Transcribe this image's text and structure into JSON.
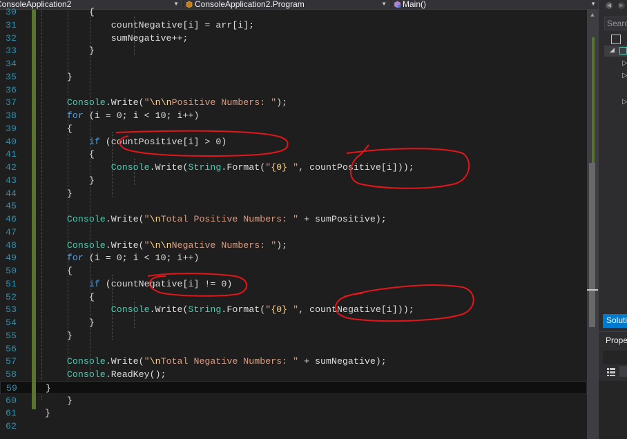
{
  "navbar": {
    "project": "ConsoleApplication2",
    "class": "ConsoleApplication2.Program",
    "member": "Main()"
  },
  "code": {
    "lines": [
      {
        "num": "30",
        "text": "                {"
      },
      {
        "num": "31",
        "text": "                    countNegative[i] = arr[i];"
      },
      {
        "num": "32",
        "text": "                    sumNegative++;"
      },
      {
        "num": "33",
        "text": "                }"
      },
      {
        "num": "34",
        "text": ""
      },
      {
        "num": "35",
        "text": "            }"
      },
      {
        "num": "36",
        "text": ""
      },
      {
        "num": "37",
        "text": "            Console.Write(\"\\n\\nPositive Numbers: \");"
      },
      {
        "num": "38",
        "text": "            for (i = 0; i < 10; i++)"
      },
      {
        "num": "39",
        "text": "            {"
      },
      {
        "num": "40",
        "text": "                if (countPositive[i] > 0)"
      },
      {
        "num": "41",
        "text": "                {"
      },
      {
        "num": "42",
        "text": "                    Console.Write(String.Format(\"{0} \", countPositive[i]));"
      },
      {
        "num": "43",
        "text": "                }"
      },
      {
        "num": "44",
        "text": "            }"
      },
      {
        "num": "45",
        "text": ""
      },
      {
        "num": "46",
        "text": "            Console.Write(\"\\nTotal Positive Numbers: \" + sumPositive);"
      },
      {
        "num": "47",
        "text": ""
      },
      {
        "num": "48",
        "text": "            Console.Write(\"\\n\\nNegative Numbers: \");"
      },
      {
        "num": "49",
        "text": "            for (i = 0; i < 10; i++)"
      },
      {
        "num": "50",
        "text": "            {"
      },
      {
        "num": "51",
        "text": "                if (countNegative[i] != 0)"
      },
      {
        "num": "52",
        "text": "                {"
      },
      {
        "num": "53",
        "text": "                    Console.Write(String.Format(\"{0} \", countNegative[i]));"
      },
      {
        "num": "54",
        "text": "                }"
      },
      {
        "num": "55",
        "text": "            }"
      },
      {
        "num": "56",
        "text": ""
      },
      {
        "num": "57",
        "text": "            Console.Write(\"\\nTotal Negative Numbers: \" + sumNegative);"
      },
      {
        "num": "58",
        "text": "            Console.ReadKey();"
      },
      {
        "num": "59",
        "text": "        }"
      },
      {
        "num": "60",
        "text": "    }"
      },
      {
        "num": "61",
        "text": "}"
      },
      {
        "num": "62",
        "text": ""
      }
    ],
    "current_line": "59"
  },
  "right_panel": {
    "search": "Search",
    "solution_explorer_tab": "Solutio",
    "properties_title": "Prope"
  },
  "colors": {
    "background": "#1e1e1e",
    "keyword": "#569cd6",
    "string": "#d69d85",
    "type": "#4ec9b0",
    "line_number": "#2b91af",
    "annotation": "#e3161b"
  },
  "icons": [
    "project-icon",
    "class-icon",
    "method-icon",
    "back-icon",
    "forward-icon",
    "sync-icon",
    "properties-grid-icon"
  ]
}
